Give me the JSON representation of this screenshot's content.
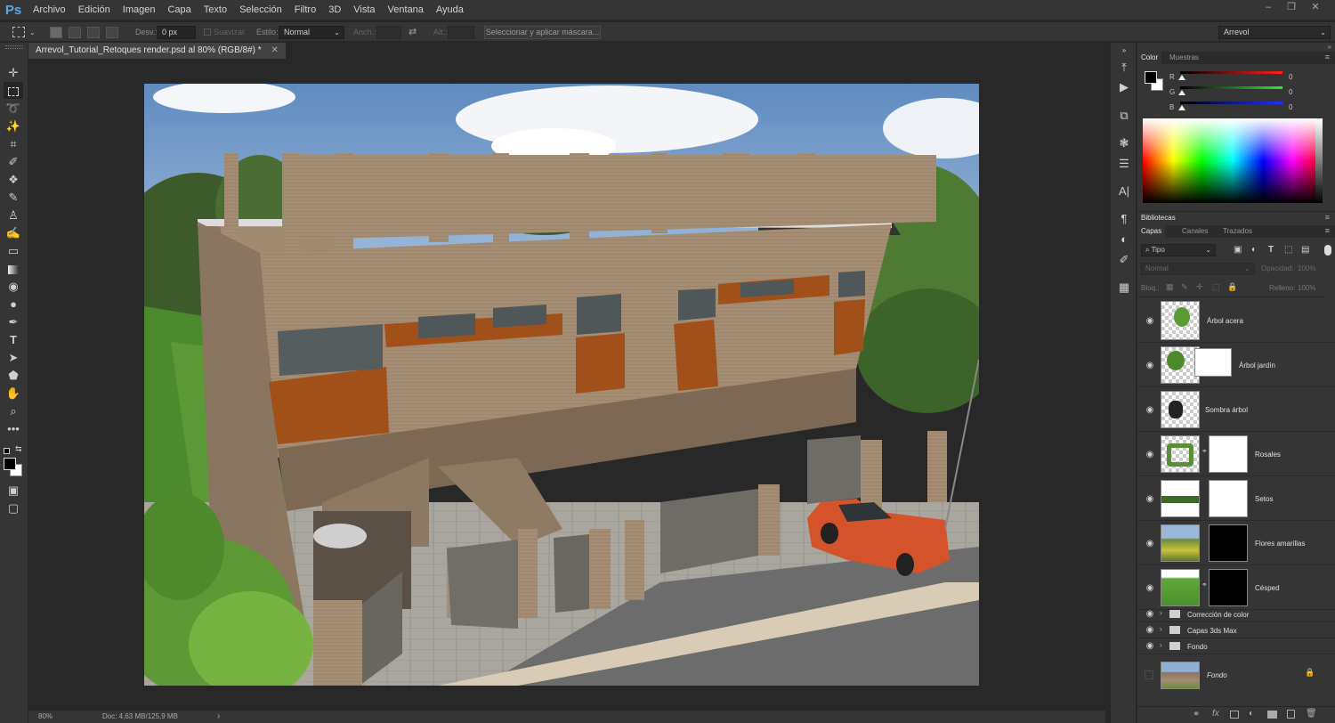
{
  "app": {
    "logo": "Ps"
  },
  "menu": [
    "Archivo",
    "Edición",
    "Imagen",
    "Capa",
    "Texto",
    "Selección",
    "Filtro",
    "3D",
    "Vista",
    "Ventana",
    "Ayuda"
  ],
  "options": {
    "feather_label": "Desv.:",
    "feather_value": "0 px",
    "antialias_label": "Suavizar",
    "style_label": "Estilo:",
    "style_value": "Normal",
    "width_label": "Anch.:",
    "height_label": "Alt.:",
    "mask_button": "Seleccionar y aplicar máscara...",
    "workspace": "Arrevol"
  },
  "document": {
    "tab_title": "Arrevol_Tutorial_Retoques render.psd al 80% (RGB/8#) *"
  },
  "status": {
    "zoom": "80%",
    "doc_info": "Doc: 4,63 MB/125,9 MB",
    "arrow": "›"
  },
  "color_panel": {
    "tabs": [
      "Color",
      "Muestras"
    ],
    "channels": [
      {
        "label": "R",
        "value": "0",
        "color": "#ff2020"
      },
      {
        "label": "G",
        "value": "0",
        "color": "#35e535"
      },
      {
        "label": "B",
        "value": "0",
        "color": "#2030ff"
      }
    ]
  },
  "libraries": {
    "title": "Bibliotecas"
  },
  "layers_panel": {
    "tabs": [
      "Capas",
      "Canales",
      "Trazados"
    ],
    "filter": "Tipo",
    "blend_mode": "Normal",
    "opacity_label": "Opacidad:",
    "opacity_value": "100%",
    "lock_label": "Bloq.:",
    "fill_label": "Relleno:",
    "fill_value": "100%",
    "layers": [
      {
        "name": "Árbol acera"
      },
      {
        "name": "Árbol jardín"
      },
      {
        "name": "Sombra árbol"
      },
      {
        "name": "Rosales"
      },
      {
        "name": "Setos"
      },
      {
        "name": "Flores amarillas"
      },
      {
        "name": "Césped"
      }
    ],
    "groups": [
      {
        "name": "Corrección de color"
      },
      {
        "name": "Capas 3ds Max"
      },
      {
        "name": "Fondo"
      }
    ],
    "background": {
      "name": "Fondo"
    }
  }
}
